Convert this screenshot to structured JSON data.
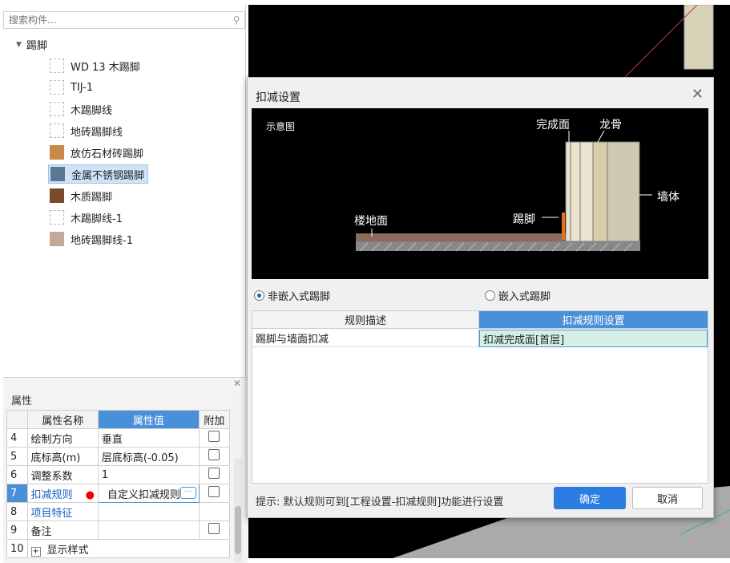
{
  "search": {
    "placeholder": "搜索构件..."
  },
  "tree": {
    "root_label": "踢脚",
    "items": [
      {
        "label": "WD 13 木踢脚",
        "color": ""
      },
      {
        "label": "TIJ-1",
        "color": ""
      },
      {
        "label": "木踢脚线",
        "color": ""
      },
      {
        "label": "地砖踢脚线",
        "color": ""
      },
      {
        "label": "放仿石材砖踢脚",
        "color": "#c8894a"
      },
      {
        "label": "金属不锈钢踢脚",
        "color": "#5a7894",
        "selected": true
      },
      {
        "label": "木质踢脚",
        "color": "#7a4a2a"
      },
      {
        "label": "木踢脚线-1",
        "color": ""
      },
      {
        "label": "地砖踢脚线-1",
        "color": "#c4a999"
      }
    ]
  },
  "props": {
    "title": "属性",
    "headers": [
      "属性名称",
      "属性值",
      "附加"
    ],
    "rows": [
      {
        "num": "4",
        "name": "绘制方向",
        "value": "垂直"
      },
      {
        "num": "5",
        "name": "底标高(m)",
        "value": "层底标高(-0.05)"
      },
      {
        "num": "6",
        "name": "调整系数",
        "value": "1"
      },
      {
        "num": "7",
        "name": "扣减规则",
        "value": "自定义扣减规则"
      },
      {
        "num": "8",
        "name": "项目特征",
        "value": ""
      },
      {
        "num": "9",
        "name": "备注",
        "value": ""
      },
      {
        "num": "10",
        "name": "显示样式",
        "value": ""
      }
    ]
  },
  "dialog": {
    "title": "扣减设置",
    "diagram": {
      "title": "示意图",
      "labels": {
        "finish": "完成面",
        "keel": "龙骨",
        "wall": "墙体",
        "floor": "楼地面",
        "baseboard": "踢脚"
      }
    },
    "radio_non_embedded": "非嵌入式踢脚",
    "radio_embedded": "嵌入式踢脚",
    "grid": {
      "headers": [
        "规则描述",
        "扣减规则设置"
      ],
      "row": [
        "踢脚与墙面扣减",
        "扣减完成面[首层]"
      ]
    },
    "hint": "提示: 默认规则可到[工程设置-扣减规则]功能进行设置",
    "ok": "确定",
    "cancel": "取消"
  }
}
